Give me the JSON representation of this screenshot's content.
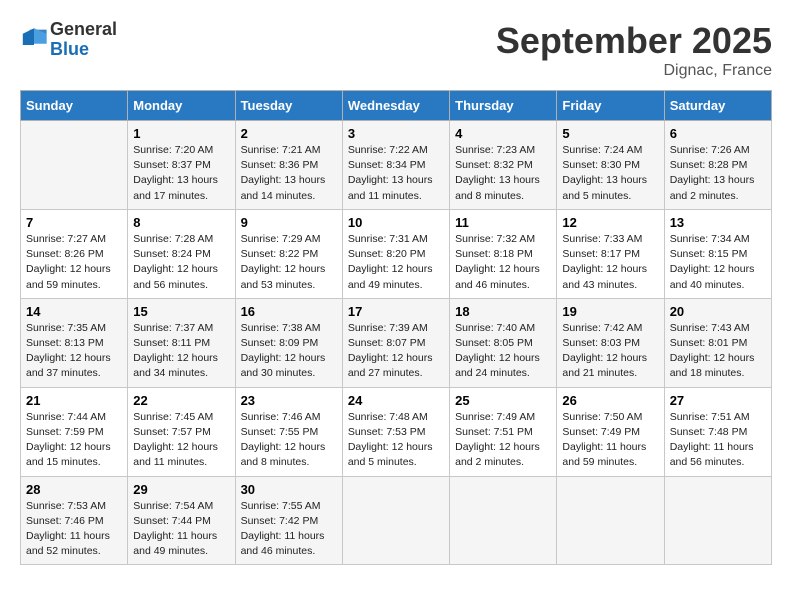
{
  "header": {
    "logo_line1": "General",
    "logo_line2": "Blue",
    "month": "September 2025",
    "location": "Dignac, France"
  },
  "weekdays": [
    "Sunday",
    "Monday",
    "Tuesday",
    "Wednesday",
    "Thursday",
    "Friday",
    "Saturday"
  ],
  "weeks": [
    [
      {
        "day": "",
        "info": ""
      },
      {
        "day": "1",
        "info": "Sunrise: 7:20 AM\nSunset: 8:37 PM\nDaylight: 13 hours\nand 17 minutes."
      },
      {
        "day": "2",
        "info": "Sunrise: 7:21 AM\nSunset: 8:36 PM\nDaylight: 13 hours\nand 14 minutes."
      },
      {
        "day": "3",
        "info": "Sunrise: 7:22 AM\nSunset: 8:34 PM\nDaylight: 13 hours\nand 11 minutes."
      },
      {
        "day": "4",
        "info": "Sunrise: 7:23 AM\nSunset: 8:32 PM\nDaylight: 13 hours\nand 8 minutes."
      },
      {
        "day": "5",
        "info": "Sunrise: 7:24 AM\nSunset: 8:30 PM\nDaylight: 13 hours\nand 5 minutes."
      },
      {
        "day": "6",
        "info": "Sunrise: 7:26 AM\nSunset: 8:28 PM\nDaylight: 13 hours\nand 2 minutes."
      }
    ],
    [
      {
        "day": "7",
        "info": "Sunrise: 7:27 AM\nSunset: 8:26 PM\nDaylight: 12 hours\nand 59 minutes."
      },
      {
        "day": "8",
        "info": "Sunrise: 7:28 AM\nSunset: 8:24 PM\nDaylight: 12 hours\nand 56 minutes."
      },
      {
        "day": "9",
        "info": "Sunrise: 7:29 AM\nSunset: 8:22 PM\nDaylight: 12 hours\nand 53 minutes."
      },
      {
        "day": "10",
        "info": "Sunrise: 7:31 AM\nSunset: 8:20 PM\nDaylight: 12 hours\nand 49 minutes."
      },
      {
        "day": "11",
        "info": "Sunrise: 7:32 AM\nSunset: 8:18 PM\nDaylight: 12 hours\nand 46 minutes."
      },
      {
        "day": "12",
        "info": "Sunrise: 7:33 AM\nSunset: 8:17 PM\nDaylight: 12 hours\nand 43 minutes."
      },
      {
        "day": "13",
        "info": "Sunrise: 7:34 AM\nSunset: 8:15 PM\nDaylight: 12 hours\nand 40 minutes."
      }
    ],
    [
      {
        "day": "14",
        "info": "Sunrise: 7:35 AM\nSunset: 8:13 PM\nDaylight: 12 hours\nand 37 minutes."
      },
      {
        "day": "15",
        "info": "Sunrise: 7:37 AM\nSunset: 8:11 PM\nDaylight: 12 hours\nand 34 minutes."
      },
      {
        "day": "16",
        "info": "Sunrise: 7:38 AM\nSunset: 8:09 PM\nDaylight: 12 hours\nand 30 minutes."
      },
      {
        "day": "17",
        "info": "Sunrise: 7:39 AM\nSunset: 8:07 PM\nDaylight: 12 hours\nand 27 minutes."
      },
      {
        "day": "18",
        "info": "Sunrise: 7:40 AM\nSunset: 8:05 PM\nDaylight: 12 hours\nand 24 minutes."
      },
      {
        "day": "19",
        "info": "Sunrise: 7:42 AM\nSunset: 8:03 PM\nDaylight: 12 hours\nand 21 minutes."
      },
      {
        "day": "20",
        "info": "Sunrise: 7:43 AM\nSunset: 8:01 PM\nDaylight: 12 hours\nand 18 minutes."
      }
    ],
    [
      {
        "day": "21",
        "info": "Sunrise: 7:44 AM\nSunset: 7:59 PM\nDaylight: 12 hours\nand 15 minutes."
      },
      {
        "day": "22",
        "info": "Sunrise: 7:45 AM\nSunset: 7:57 PM\nDaylight: 12 hours\nand 11 minutes."
      },
      {
        "day": "23",
        "info": "Sunrise: 7:46 AM\nSunset: 7:55 PM\nDaylight: 12 hours\nand 8 minutes."
      },
      {
        "day": "24",
        "info": "Sunrise: 7:48 AM\nSunset: 7:53 PM\nDaylight: 12 hours\nand 5 minutes."
      },
      {
        "day": "25",
        "info": "Sunrise: 7:49 AM\nSunset: 7:51 PM\nDaylight: 12 hours\nand 2 minutes."
      },
      {
        "day": "26",
        "info": "Sunrise: 7:50 AM\nSunset: 7:49 PM\nDaylight: 11 hours\nand 59 minutes."
      },
      {
        "day": "27",
        "info": "Sunrise: 7:51 AM\nSunset: 7:48 PM\nDaylight: 11 hours\nand 56 minutes."
      }
    ],
    [
      {
        "day": "28",
        "info": "Sunrise: 7:53 AM\nSunset: 7:46 PM\nDaylight: 11 hours\nand 52 minutes."
      },
      {
        "day": "29",
        "info": "Sunrise: 7:54 AM\nSunset: 7:44 PM\nDaylight: 11 hours\nand 49 minutes."
      },
      {
        "day": "30",
        "info": "Sunrise: 7:55 AM\nSunset: 7:42 PM\nDaylight: 11 hours\nand 46 minutes."
      },
      {
        "day": "",
        "info": ""
      },
      {
        "day": "",
        "info": ""
      },
      {
        "day": "",
        "info": ""
      },
      {
        "day": "",
        "info": ""
      }
    ]
  ]
}
